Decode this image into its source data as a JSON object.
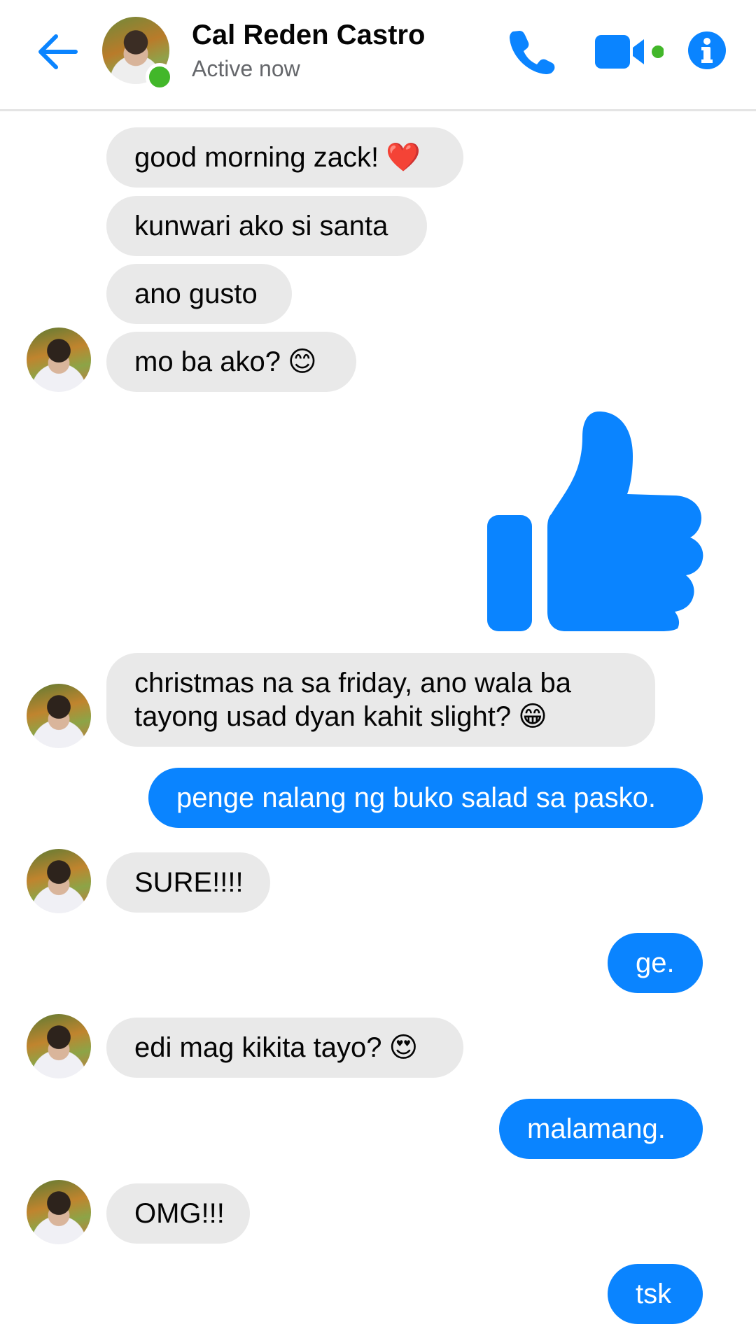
{
  "header": {
    "contact_name": "Cal Reden Castro",
    "status": "Active now"
  },
  "colors": {
    "accent": "#0a84ff",
    "incoming_bg": "#e9e9e9",
    "online": "#42b72a"
  },
  "messages": [
    {
      "from": "contact",
      "text": "good morning zack!",
      "emoji": "❤️"
    },
    {
      "from": "contact",
      "text": "kunwari ako si santa",
      "emoji": ""
    },
    {
      "from": "contact",
      "text": "ano gusto",
      "emoji": ""
    },
    {
      "from": "contact",
      "text": "mo ba ako?",
      "emoji": "😊"
    },
    {
      "from": "me",
      "type": "like-sticker",
      "icon": "thumbs-up-icon"
    },
    {
      "from": "contact",
      "text": "christmas na sa friday, ano wala ba",
      "text2": "tayong usad dyan kahit slight?",
      "emoji": "😁"
    },
    {
      "from": "me",
      "text": "penge nalang ng buko salad sa pasko."
    },
    {
      "from": "contact",
      "text": "SURE!!!!"
    },
    {
      "from": "me",
      "text": "ge."
    },
    {
      "from": "contact",
      "text": "edi mag kikita tayo?",
      "emoji": "😍"
    },
    {
      "from": "me",
      "text": "malamang."
    },
    {
      "from": "contact",
      "text": "OMG!!!"
    },
    {
      "from": "me",
      "text": "tsk"
    }
  ]
}
